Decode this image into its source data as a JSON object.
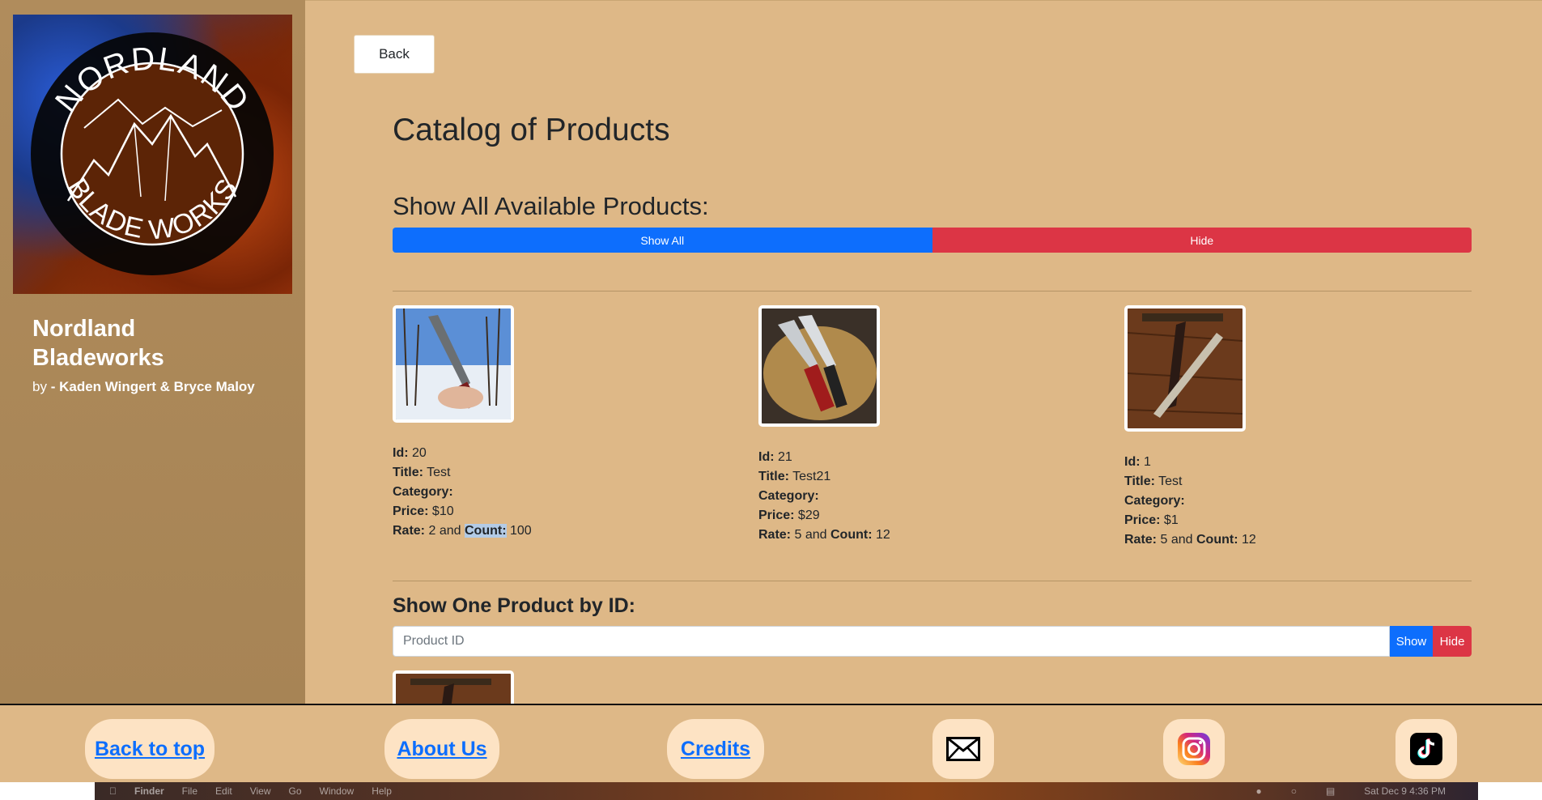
{
  "sidebar": {
    "logo_alt": "NORDLAND BLADE WORKS",
    "logo_top_text": "NORDLAND",
    "logo_bottom_text": "BLADE WORKS",
    "brand_line1": "Nordland",
    "brand_line2": "Bladeworks",
    "by_prefix": "by",
    "authors": "- Kaden Wingert & Bryce Maloy"
  },
  "main": {
    "back_label": "Back",
    "title": "Catalog of Products",
    "show_all_heading": "Show All Available Products:",
    "show_all_label": "Show All",
    "hide_label": "Hide",
    "products": [
      {
        "id_label": "Id:",
        "id": "20",
        "title_label": "Title:",
        "title": "Test",
        "category_label": "Category:",
        "category": "",
        "price_label": "Price:",
        "price": "$10",
        "rate_label": "Rate:",
        "rate": "2",
        "and": "and",
        "count_label": "Count:",
        "count": "100"
      },
      {
        "id_label": "Id:",
        "id": "21",
        "title_label": "Title:",
        "title": "Test21",
        "category_label": "Category:",
        "category": "",
        "price_label": "Price:",
        "price": "$29",
        "rate_label": "Rate:",
        "rate": "5",
        "and": "and",
        "count_label": "Count:",
        "count": "12"
      },
      {
        "id_label": "Id:",
        "id": "1",
        "title_label": "Title:",
        "title": "Test",
        "category_label": "Category:",
        "category": "",
        "price_label": "Price:",
        "price": "$1",
        "rate_label": "Rate:",
        "rate": "5",
        "and": "and",
        "count_label": "Count:",
        "count": "12"
      }
    ],
    "one_product_heading": "Show One Product by ID:",
    "product_id_placeholder": "Product ID",
    "show_label": "Show",
    "hide_small_label": "Hide"
  },
  "footer": {
    "back_to_top": "Back to top",
    "about_us": "About Us",
    "credits": "Credits",
    "link_color": "#0d6efd"
  },
  "macbar": {
    "items": [
      "Finder",
      "File",
      "Edit",
      "View",
      "Go",
      "Window",
      "Help"
    ],
    "clock": "Sat Dec 9  4:36 PM"
  },
  "colors": {
    "main_bg": "#deb887",
    "sidebar_bg": "#a98656",
    "primary": "#0d6efd",
    "danger": "#dc3545",
    "pill_bg": "#fde3c4"
  }
}
